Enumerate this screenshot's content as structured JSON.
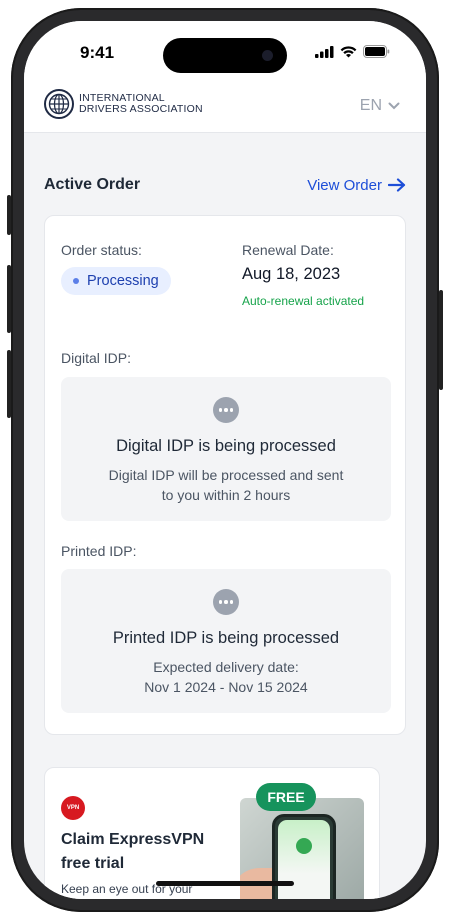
{
  "status_bar": {
    "time": "9:41"
  },
  "header": {
    "logo_line1": "INTERNATIONAL",
    "logo_line2": "DRIVERS ASSOCIATION",
    "language": "EN"
  },
  "active_order": {
    "title": "Active Order",
    "view_link": "View Order",
    "order_status_label": "Order status:",
    "status": "Processing",
    "renewal_label": "Renewal Date:",
    "renewal_date": "Aug 18, 2023",
    "auto_renewal": "Auto-renewal activated",
    "digital": {
      "label": "Digital IDP:",
      "title": "Digital IDP is being processed",
      "line1": "Digital IDP will be processed and sent",
      "line2": "to you within 2 hours"
    },
    "printed": {
      "label": "Printed IDP:",
      "title": "Printed IDP is being processed",
      "line1": "Expected delivery date:",
      "line2": "Nov 1 2024 - Nov 15 2024"
    }
  },
  "promo": {
    "icon_text": "VPN",
    "title_line1": "Claim ExpressVPN",
    "title_line2": "free trial",
    "description": "Keep an eye out for your",
    "badge": "FREE"
  },
  "colors": {
    "accent": "#1d4ed8",
    "success": "#16a34a",
    "free_badge": "#16935c",
    "status_bg": "#e8efff"
  }
}
